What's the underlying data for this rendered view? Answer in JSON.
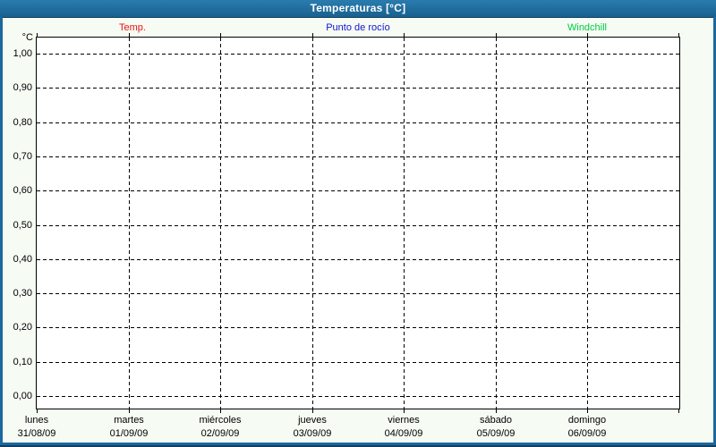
{
  "window": {
    "title": "Temperaturas [°C]",
    "colors": {
      "frame": "#1b689e",
      "frame_dark": "#113f60",
      "background": "#f6fbf4",
      "plot_background": "#ffffff",
      "grid": "#000000",
      "title_text": "#ffffff"
    }
  },
  "chart_data": {
    "type": "line",
    "title": "Temperaturas [°C]",
    "xlabel": "",
    "ylabel": "°C",
    "ylim": [
      0.0,
      1.0
    ],
    "ytick_step": 0.1,
    "ytick_labels": [
      "1,00",
      "0,90",
      "0,80",
      "0,70",
      "0,60",
      "0,50",
      "0,40",
      "0,30",
      "0,20",
      "0,10",
      "0,00"
    ],
    "grid": "dashed",
    "legend_position": "top",
    "x_categories": [
      {
        "day": "lunes",
        "date": "31/08/09"
      },
      {
        "day": "martes",
        "date": "01/09/09"
      },
      {
        "day": "miércoles",
        "date": "02/09/09"
      },
      {
        "day": "jueves",
        "date": "03/09/09"
      },
      {
        "day": "viernes",
        "date": "04/09/09"
      },
      {
        "day": "sábado",
        "date": "05/09/09"
      },
      {
        "day": "domingo",
        "date": "06/09/09"
      }
    ],
    "series": [
      {
        "name": "Temp.",
        "color": "#e81515",
        "values": []
      },
      {
        "name": "Punto de rocío",
        "color": "#1414d2",
        "values": []
      },
      {
        "name": "Windchill",
        "color": "#00cc44",
        "values": []
      }
    ]
  }
}
